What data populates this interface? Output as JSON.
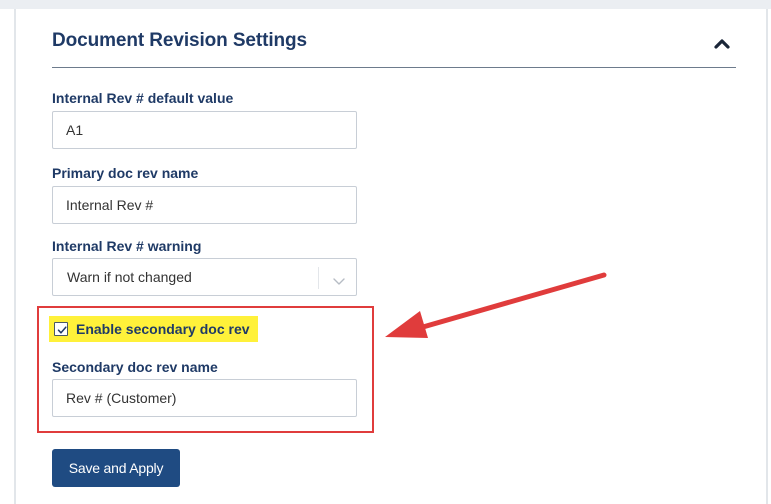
{
  "section": {
    "title": "Document Revision Settings",
    "collapse_icon": "chevron-up-icon"
  },
  "fields": {
    "internal_rev_default": {
      "label": "Internal Rev # default value",
      "value": "A1"
    },
    "primary_rev_name": {
      "label": "Primary doc rev name",
      "value": "Internal Rev #"
    },
    "internal_rev_warning": {
      "label": "Internal Rev # warning",
      "selected": "Warn if not changed",
      "icon": "chevron-down-icon"
    },
    "enable_secondary": {
      "label": "Enable secondary doc rev",
      "checked": true,
      "icon": "checkmark-icon"
    },
    "secondary_rev_name": {
      "label": "Secondary doc rev name",
      "value": "Rev # (Customer)"
    }
  },
  "actions": {
    "save_label": "Save and Apply"
  },
  "colors": {
    "heading": "#1f3a66",
    "button": "#1f4b82",
    "annotation_red": "#e03c3c",
    "highlight_yellow": "#fff13a"
  }
}
